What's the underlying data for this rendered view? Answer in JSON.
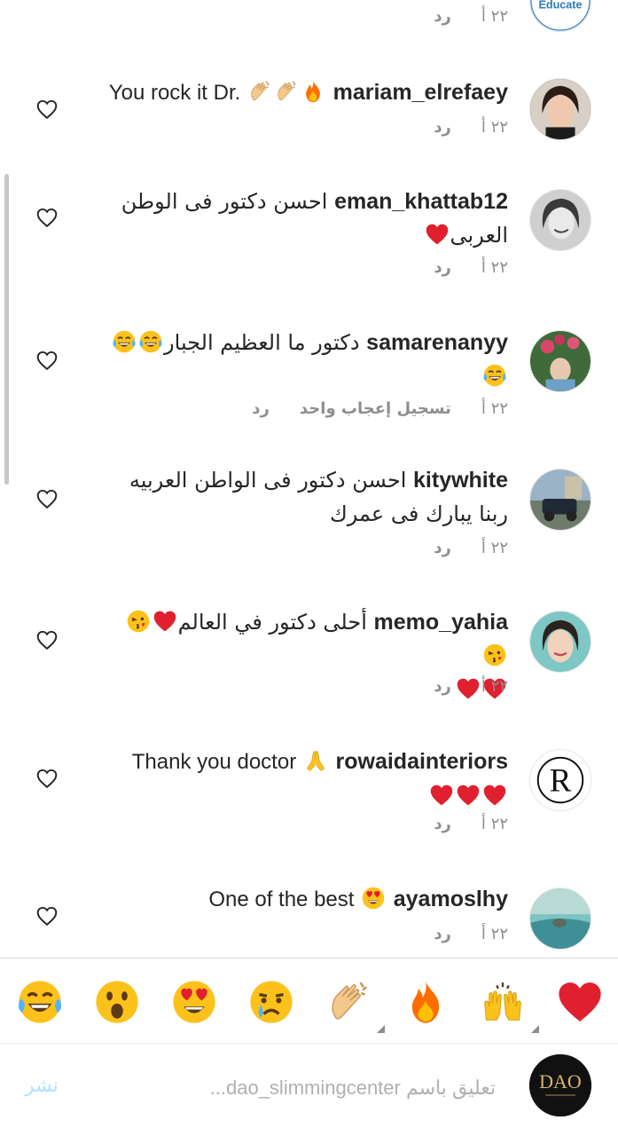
{
  "top_partial": {
    "avatar_label": "Educate",
    "time": "٢٢ أ",
    "reply": "رد"
  },
  "comments": [
    {
      "username": "mariam_elrefaey",
      "text": "You rock it Dr.",
      "emojis": [
        "fire",
        "clap",
        "clap"
      ],
      "time": "٢٢ أ",
      "reply": "رد"
    },
    {
      "username": "eman_khattab12",
      "text": "احسن دكتور فى الوطن العربى",
      "emojis_after": [
        "heart"
      ],
      "time": "٢٢ أ",
      "reply": "رد"
    },
    {
      "username": "samarenanyy",
      "text": "دكتور ما العظيم الجبار",
      "emojis_after": [
        "joy",
        "joy",
        "joy"
      ],
      "time": "٢٢ أ",
      "likes_text": "تسجيل إعجاب واحد",
      "reply": "رد"
    },
    {
      "username": "kitywhite",
      "text": "احسن دكتور فى الواطن العربيه ربنا يبارك فى عمرك",
      "time": "٢٢ أ",
      "reply": "رد"
    },
    {
      "username": "memo_yahia",
      "text": "أحلى دكتور في العالم",
      "emojis_after": [
        "heart",
        "kiss",
        "kiss",
        "heart",
        "heart"
      ],
      "time": "٢٢ أ",
      "reply": "رد"
    },
    {
      "username": "rowaidainteriors",
      "text": "Thank you doctor",
      "emojis": [
        "pray"
      ],
      "emojis_after": [
        "heart",
        "heart",
        "heart"
      ],
      "time": "٢٢ أ",
      "reply": "رد"
    },
    {
      "username": "ayamoslhy",
      "text": "One of the best",
      "emojis": [
        "heart_eyes"
      ],
      "time": "٢٢ أ",
      "reply": "رد"
    }
  ],
  "reactions": [
    "heart",
    "raised-hands",
    "fire",
    "clap",
    "cry",
    "heart-eyes",
    "open-mouth",
    "joy"
  ],
  "compose": {
    "placeholder": "تعليق باسم dao_slimmingcenter...",
    "post_label": "نشر",
    "avatar_label": "DAO"
  },
  "colors": {
    "text": "#262626",
    "meta": "#8e8e8e",
    "heart_red": "#e0202e",
    "post_disabled": "#b2dffc"
  }
}
